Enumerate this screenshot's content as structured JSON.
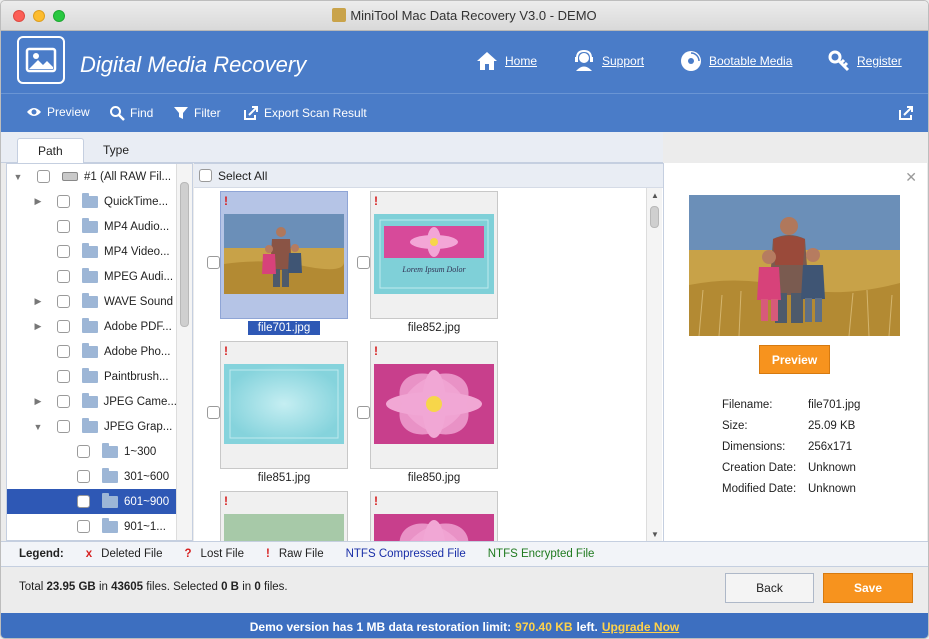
{
  "window": {
    "title": "MiniTool Mac Data Recovery V3.0 - DEMO"
  },
  "header": {
    "brand": "Digital Media Recovery",
    "nav": [
      {
        "label": "Home",
        "icon": "home-icon"
      },
      {
        "label": "Support",
        "icon": "support-icon"
      },
      {
        "label": "Bootable Media",
        "icon": "disc-icon"
      },
      {
        "label": "Register",
        "icon": "key-icon"
      }
    ]
  },
  "toolbar": {
    "preview": "Preview",
    "find": "Find",
    "filter": "Filter",
    "export": "Export Scan Result"
  },
  "tabs": [
    "Path",
    "Type"
  ],
  "tree": {
    "items": [
      {
        "label": "#1 (All RAW Fil...",
        "expander": "down",
        "kind": "drive"
      },
      {
        "label": "QuickTime...",
        "expander": "right",
        "kind": "folder"
      },
      {
        "label": "MP4 Audio...",
        "expander": "",
        "kind": "folder"
      },
      {
        "label": "MP4 Video...",
        "expander": "",
        "kind": "folder"
      },
      {
        "label": "MPEG Audi...",
        "expander": "",
        "kind": "folder"
      },
      {
        "label": "WAVE Sound",
        "expander": "right",
        "kind": "folder"
      },
      {
        "label": "Adobe PDF...",
        "expander": "right",
        "kind": "folder"
      },
      {
        "label": "Adobe Pho...",
        "expander": "",
        "kind": "folder"
      },
      {
        "label": "Paintbrush...",
        "expander": "",
        "kind": "folder"
      },
      {
        "label": "JPEG Came...",
        "expander": "right",
        "kind": "folder"
      },
      {
        "label": "JPEG Grap...",
        "expander": "down",
        "kind": "folder"
      },
      {
        "label": "1~300",
        "expander": "",
        "kind": "folder"
      },
      {
        "label": "301~600",
        "expander": "",
        "kind": "folder"
      },
      {
        "label": "601~900",
        "expander": "",
        "kind": "folder",
        "selected": true
      },
      {
        "label": "901~1...",
        "expander": "",
        "kind": "folder"
      }
    ]
  },
  "grid": {
    "select_all": "Select All",
    "files": [
      {
        "name": "file701.jpg",
        "selected": true,
        "thumb": "family"
      },
      {
        "name": "file852.jpg",
        "selected": false,
        "thumb": "flower-card"
      },
      {
        "name": "file851.jpg",
        "selected": false,
        "thumb": "blank-card"
      },
      {
        "name": "file850.jpg",
        "selected": false,
        "thumb": "flower"
      },
      {
        "name": "",
        "selected": false,
        "thumb": "green-flower"
      },
      {
        "name": "",
        "selected": false,
        "thumb": "flower"
      }
    ],
    "card_text": "Lorem Ipsum Dolor"
  },
  "preview": {
    "button": "Preview",
    "info": [
      {
        "key": "Filename:",
        "value": "file701.jpg"
      },
      {
        "key": "Size:",
        "value": "25.09 KB"
      },
      {
        "key": "Dimensions:",
        "value": "256x171"
      },
      {
        "key": "Creation Date:",
        "value": "Unknown"
      },
      {
        "key": "Modified Date:",
        "value": "Unknown"
      }
    ]
  },
  "legend": {
    "label": "Legend:",
    "items": [
      {
        "mark": "x",
        "text": "Deleted File",
        "color": "#d62020"
      },
      {
        "mark": "?",
        "text": "Lost File",
        "color": "#d62020"
      },
      {
        "mark": "!",
        "text": "Raw File",
        "color": "#d62020"
      },
      {
        "mark": "",
        "text": "NTFS Compressed File",
        "color": "#1a2fa8"
      },
      {
        "mark": "",
        "text": "NTFS Encrypted File",
        "color": "#1f7a1f"
      }
    ]
  },
  "status": {
    "total_prefix": "Total",
    "total_size": "23.95 GB",
    "in": "in",
    "total_files": "43605",
    "files_sel": "files.  Selected",
    "sel_size": "0 B",
    "in2": "in",
    "sel_files": "0",
    "files_end": "files."
  },
  "buttons": {
    "back": "Back",
    "save": "Save"
  },
  "demo": {
    "prefix": "Demo version has 1 MB data restoration limit:",
    "left_amount": "970.40 KB",
    "suffix": "left.",
    "upgrade": "Upgrade Now"
  },
  "colors": {
    "header_blue": "#4a7cc8",
    "accent_orange": "#f7931e",
    "select_blue": "#2e58b5"
  }
}
